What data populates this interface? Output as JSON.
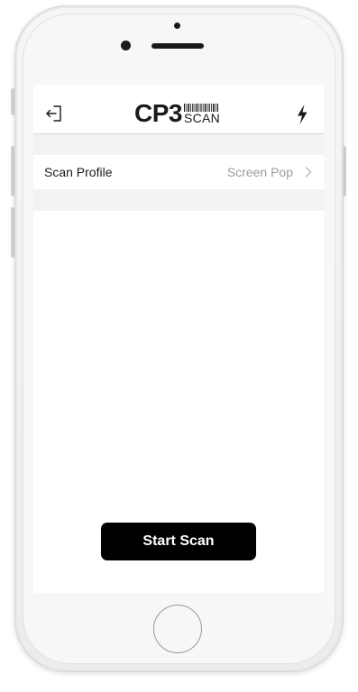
{
  "header": {
    "logo_main": "CP3",
    "logo_sub": "SCAN",
    "left_icon": "logout-icon",
    "right_icon": "flash-icon"
  },
  "settings": {
    "scan_profile_label": "Scan Profile",
    "scan_profile_value": "Screen Pop",
    "chevron_icon": "chevron-right-icon"
  },
  "actions": {
    "start_scan_label": "Start Scan"
  },
  "colors": {
    "button_bg": "#000000",
    "button_text": "#ffffff",
    "value_text": "#9c9c9c",
    "section_bg": "#f3f3f4"
  }
}
